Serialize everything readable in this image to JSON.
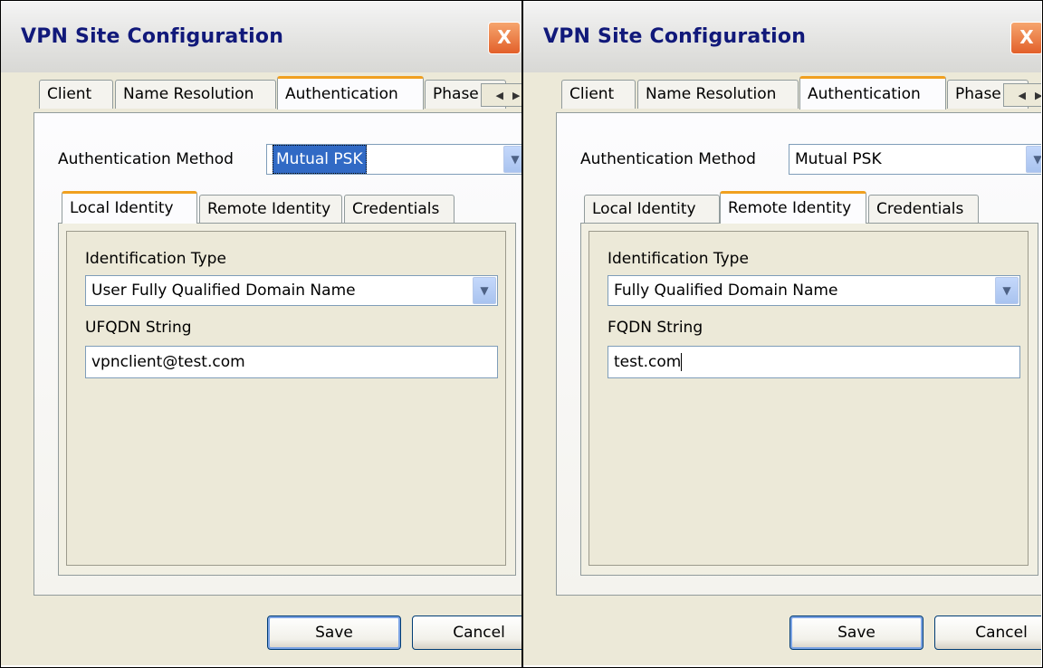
{
  "left_window": {
    "title": "VPN Site Configuration",
    "close_symbol": "X",
    "tabs": [
      {
        "label": "Client"
      },
      {
        "label": "Name Resolution"
      },
      {
        "label": "Authentication"
      },
      {
        "label": "Phase"
      }
    ],
    "tab_scroll_left": "◀",
    "tab_scroll_right": "▶",
    "auth_method_label": "Authentication Method",
    "auth_method_value": "Mutual PSK",
    "sub_tabs": [
      {
        "label": "Local Identity"
      },
      {
        "label": "Remote Identity"
      },
      {
        "label": "Credentials"
      }
    ],
    "id_type_label": "Identification Type",
    "id_type_value": "User Fully Qualified Domain Name",
    "string_label": "UFQDN String",
    "string_value": "vpnclient@test.com",
    "save_label": "Save",
    "cancel_label": "Cancel"
  },
  "right_window": {
    "title": "VPN Site Configuration",
    "close_symbol": "X",
    "tabs": [
      {
        "label": "Client"
      },
      {
        "label": "Name Resolution"
      },
      {
        "label": "Authentication"
      },
      {
        "label": "Phase"
      }
    ],
    "tab_scroll_left": "◀",
    "tab_scroll_right": "▶",
    "auth_method_label": "Authentication Method",
    "auth_method_value": "Mutual PSK",
    "sub_tabs": [
      {
        "label": "Local Identity"
      },
      {
        "label": "Remote Identity"
      },
      {
        "label": "Credentials"
      }
    ],
    "id_type_label": "Identification Type",
    "id_type_value": "Fully Qualified Domain Name",
    "string_label": "FQDN String",
    "string_value": "test.com",
    "save_label": "Save",
    "cancel_label": "Cancel"
  },
  "dropdown_icon": "chevron-down-icon",
  "colors": {
    "title_text": "#11197a",
    "tab_highlight": "#f0a020",
    "selection": "#316ac5",
    "close_button": "#e2602a"
  }
}
